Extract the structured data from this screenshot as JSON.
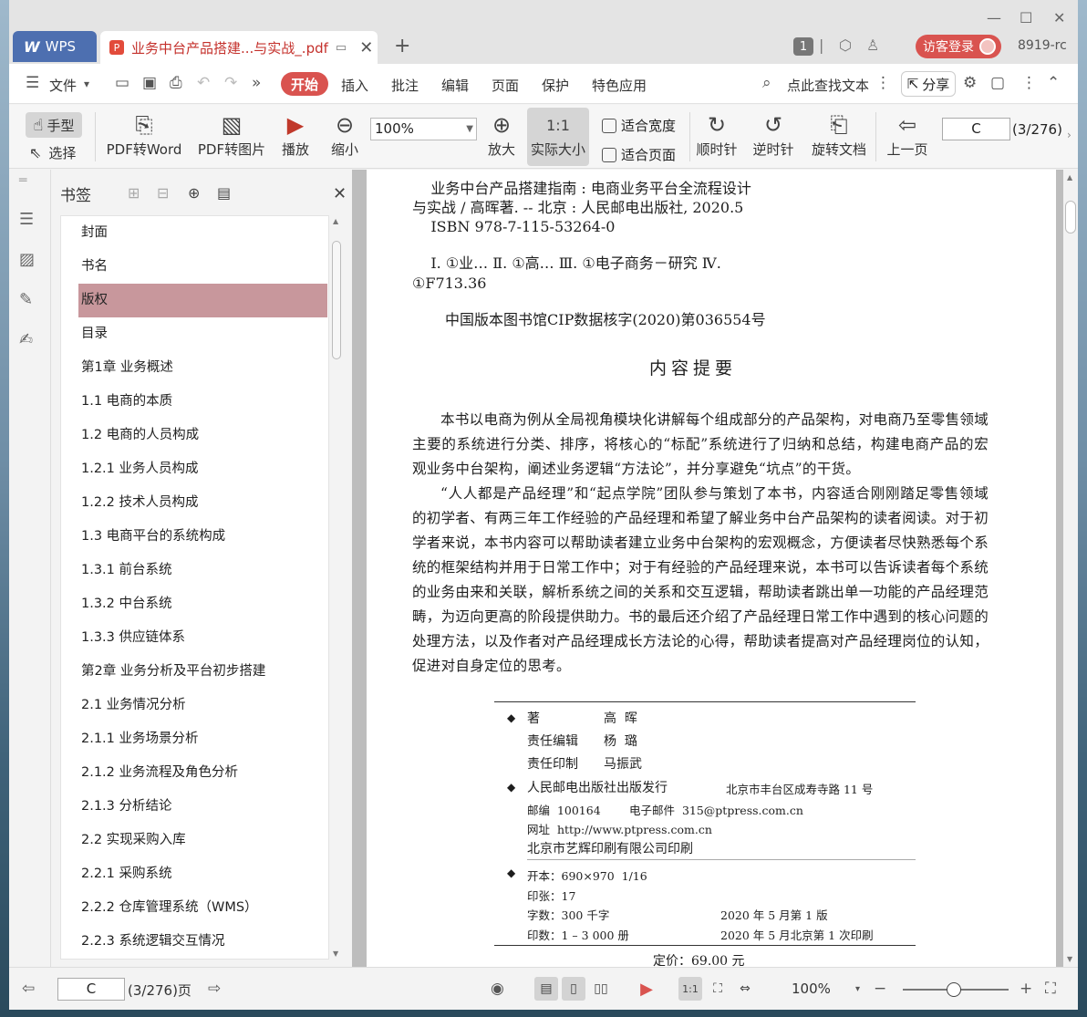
{
  "window": {
    "wps_tab": "WPS",
    "doc_tab": "业务中台产品搭建...与实战_.pdf",
    "badge": "1",
    "login_label": "访客登录",
    "user_label": "8919-rc"
  },
  "menu": {
    "file": "文件",
    "start": "开始",
    "items": [
      "插入",
      "批注",
      "编辑",
      "页面",
      "保护",
      "特色应用"
    ],
    "search": "点此查找文本",
    "share": "分享"
  },
  "toolbar": {
    "hand": "手型",
    "select": "选择",
    "pdf_to_word": "PDF转Word",
    "pdf_to_image": "PDF转图片",
    "play": "播放",
    "zoom_out": "缩小",
    "zoom_value": "100%",
    "zoom_in": "放大",
    "actual_size": "实际大小",
    "fit_width": "适合宽度",
    "fit_page": "适合页面",
    "rotate_cw": "顺时针",
    "rotate_ccw": "逆时针",
    "rotate_doc": "旋转文档",
    "prev_page": "上一页",
    "page_value": "C",
    "page_count": "(3/276)"
  },
  "bookmarks": {
    "title": "书签",
    "items": [
      "封面",
      "书名",
      "版权",
      "目录",
      "第1章  业务概述",
      "1.1  电商的本质",
      "1.2  电商的人员构成",
      "1.2.1  业务人员构成",
      "1.2.2  技术人员构成",
      "1.3  电商平台的系统构成",
      "1.3.1  前台系统",
      "1.3.2  中台系统",
      "1.3.3  供应链体系",
      "第2章  业务分析及平台初步搭建",
      "2.1  业务情况分析",
      "2.1.1  业务场景分析",
      "2.1.2  业务流程及角色分析",
      "2.1.3  分析结论",
      "2.2  实现采购入库",
      "2.2.1  采购系统",
      "2.2.2  仓库管理系统（WMS）",
      "2.2.3  系统逻辑交互情况"
    ],
    "selected_index": 2
  },
  "document": {
    "cip_lines": [
      "    业务中台产品搭建指南 : 电商业务平台全流程设计",
      "与实战 / 高晖著. -- 北京 : 人民邮电出版社, 2020.5",
      "    ISBN 978-7-115-53264-0"
    ],
    "class_lines": [
      "    Ⅰ. ①业… Ⅱ. ①高… Ⅲ. ①电子商务－研究 Ⅳ.",
      "①F713.36"
    ],
    "cip_number": "中国版本图书馆CIP数据核字(2020)第036554号",
    "summary_title": "内容提要",
    "para1": "本书以电商为例从全局视角模块化讲解每个组成部分的产品架构，对电商乃至零售领域主要的系统进行分类、排序，将核心的“标配”系统进行了归纳和总结，构建电商产品的宏观业务中台架构，阐述业务逻辑“方法论”，并分享避免“坑点”的干货。",
    "para2": "“人人都是产品经理”和“起点学院”团队参与策划了本书，内容适合刚刚踏足零售领域的初学者、有两三年工作经验的产品经理和希望了解业务中台产品架构的读者阅读。对于初学者来说，本书内容可以帮助读者建立业务中台架构的宏观概念，方便读者尽快熟悉每个系统的框架结构并用于日常工作中；对于有经验的产品经理来说，本书可以告诉读者每个系统的业务由来和关联，解析系统之间的关系和交互逻辑，帮助读者跳出单一功能的产品经理范畴，为迈向更高的阶段提供助力。书的最后还介绍了产品经理日常工作中遇到的核心问题的处理方法，以及作者对产品经理成长方法论的心得，帮助读者提高对产品经理岗位的认知，促进对自身定位的思考。",
    "colophon": {
      "author_label": "著",
      "author": "高  晖",
      "editor_label": "责任编辑",
      "editor": "杨  璐",
      "printer_label": "责任印制",
      "printer": "马振武",
      "publisher": "人民邮电出版社出版发行",
      "address": "北京市丰台区成寿寺路 11 号",
      "postcode": "邮编  100164",
      "email": "电子邮件  315@ptpress.com.cn",
      "website": "网址  http://www.ptpress.com.cn",
      "print_house": "北京市艺辉印刷有限公司印刷",
      "format": "开本：690×970  1/16",
      "sheets": "印张：17",
      "words": "字数：300 千字",
      "edition": "2020 年 5 月第 1 版",
      "copies": "印数：1 – 3 000 册",
      "printing": "2020 年 5 月北京第 1 次印刷",
      "price": "定价：69.00 元"
    }
  },
  "status": {
    "page_value": "C",
    "page_count": "(3/276)页",
    "zoom": "100%"
  }
}
